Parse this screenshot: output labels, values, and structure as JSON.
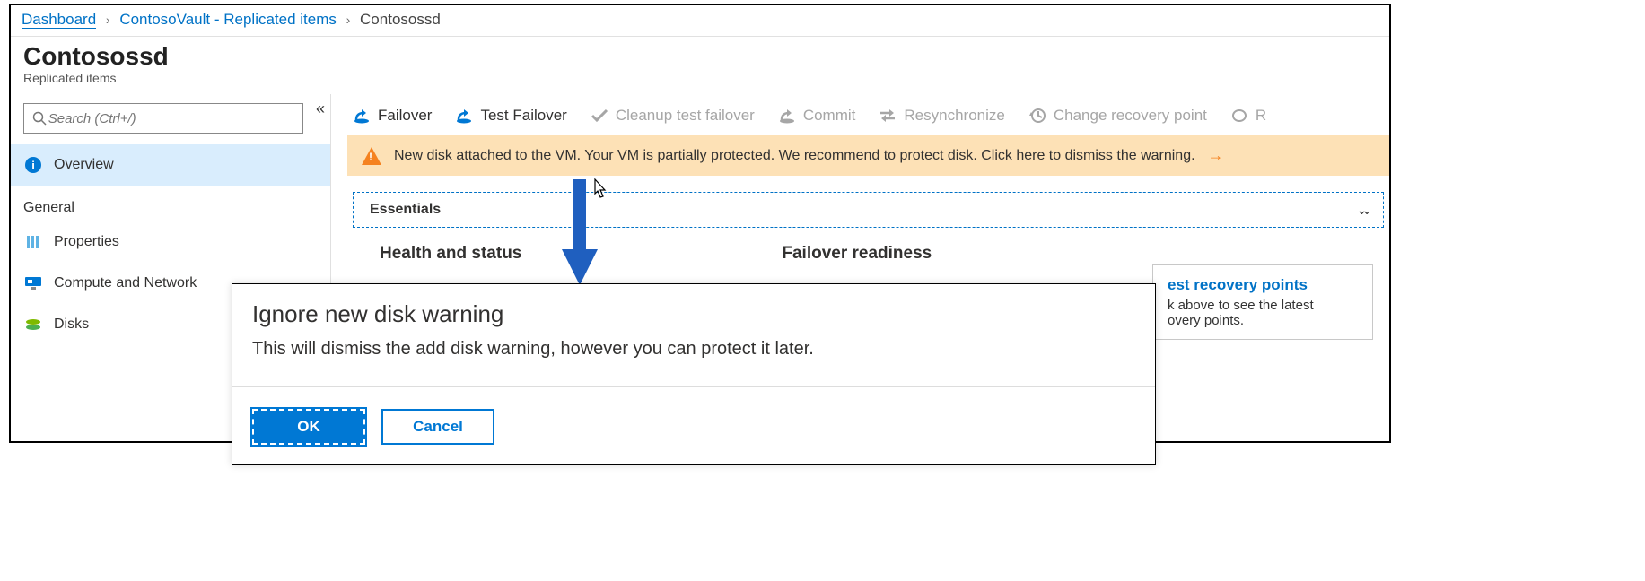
{
  "breadcrumb": {
    "items": [
      {
        "label": "Dashboard"
      },
      {
        "label": "ContosoVault - Replicated items"
      },
      {
        "label": "Contosossd"
      }
    ]
  },
  "header": {
    "title": "Contosossd",
    "subtitle": "Replicated items"
  },
  "sidebar": {
    "search_placeholder": "Search (Ctrl+/)",
    "overview": "Overview",
    "section_general": "General",
    "items": [
      {
        "label": "Properties"
      },
      {
        "label": "Compute and Network"
      },
      {
        "label": "Disks"
      }
    ]
  },
  "toolbar": {
    "failover": "Failover",
    "test_failover": "Test Failover",
    "cleanup": "Cleanup test failover",
    "commit": "Commit",
    "resync": "Resynchronize",
    "change_point": "Change recovery point",
    "extra": "R"
  },
  "banner": {
    "text": "New disk attached to the VM. Your VM is partially protected. We recommend to protect disk. Click here to dismiss the warning."
  },
  "essentials": {
    "label": "Essentials"
  },
  "sections": {
    "health": "Health and status",
    "readiness": "Failover readiness"
  },
  "recovery_card": {
    "title_visible": "est recovery points",
    "body_line1": "k above to see the latest",
    "body_line2": "overy points."
  },
  "dialog": {
    "title": "Ignore new disk warning",
    "body": "This will dismiss the add disk warning, however you can protect it later.",
    "ok": "OK",
    "cancel": "Cancel"
  }
}
